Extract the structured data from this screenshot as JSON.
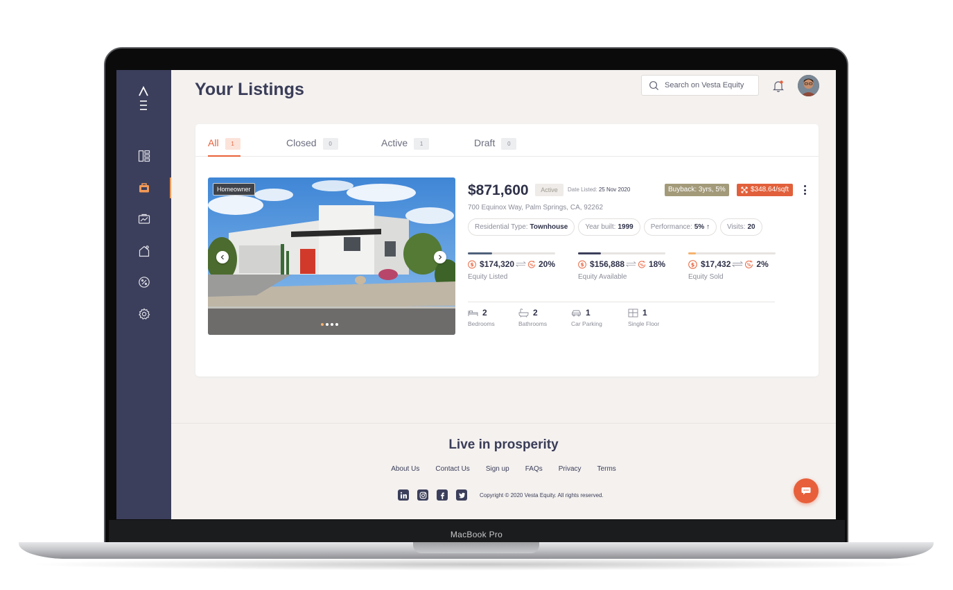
{
  "device": {
    "label": "MacBook Pro"
  },
  "header": {
    "title": "Your Listings",
    "search_placeholder": "Search on Vesta Equity"
  },
  "sidebar": {
    "items": [
      {
        "name": "dashboard",
        "icon": "dashboard-icon",
        "active": false
      },
      {
        "name": "listings",
        "icon": "briefcase-icon",
        "active": true
      },
      {
        "name": "portfolio",
        "icon": "chart-icon",
        "active": false
      },
      {
        "name": "homes",
        "icon": "house-icon",
        "active": false
      },
      {
        "name": "offers",
        "icon": "percent-badge-icon",
        "active": false
      },
      {
        "name": "settings",
        "icon": "gear-icon",
        "active": false
      }
    ]
  },
  "tabs": [
    {
      "label": "All",
      "count": "1",
      "active": true
    },
    {
      "label": "Closed",
      "count": "0",
      "active": false
    },
    {
      "label": "Active",
      "count": "1",
      "active": false
    },
    {
      "label": "Draft",
      "count": "0",
      "active": false
    }
  ],
  "listing": {
    "badge": "Homeowner",
    "price": "$871,600",
    "status": "Active",
    "date_label": "Date Listed:",
    "date": "25 Nov 2020",
    "buyback": "Buyback: 3yrs, 5%",
    "price_per_sqft": "$348.64/sqft",
    "address": "700 Equinox Way, Palm Springs, CA, 92262",
    "chips": [
      {
        "label": "Residential Type:",
        "value": "Townhouse"
      },
      {
        "label": "Year built:",
        "value": "1999"
      },
      {
        "label": "Performance:",
        "value": "5% ↑"
      },
      {
        "label": "Visits:",
        "value": "20"
      }
    ],
    "equity": [
      {
        "amount": "$174,320",
        "percent": "20%",
        "label": "Equity Listed",
        "fill": 0.28,
        "color": "#50617a"
      },
      {
        "amount": "$156,888",
        "percent": "18%",
        "label": "Equity Available",
        "fill": 0.26,
        "color": "#3c3f5b"
      },
      {
        "amount": "$17,432",
        "percent": "2%",
        "label": "Equity Sold",
        "fill": 0.09,
        "color": "#f5b26f"
      }
    ],
    "features": [
      {
        "value": "2",
        "label": "Bedrooms",
        "icon": "bed-icon"
      },
      {
        "value": "2",
        "label": "Bathrooms",
        "icon": "bathtub-icon"
      },
      {
        "value": "1",
        "label": "Car Parking",
        "icon": "car-icon"
      },
      {
        "value": "1",
        "label": "Single Floor",
        "icon": "floor-plan-icon"
      }
    ],
    "photo_count": 4,
    "photo_index": 1
  },
  "footer": {
    "tagline": "Live in prosperity",
    "links": [
      "About Us",
      "Contact Us",
      "Sign up",
      "FAQs",
      "Privacy",
      "Terms"
    ],
    "social": [
      "linkedin-icon",
      "instagram-icon",
      "facebook-icon",
      "twitter-icon"
    ],
    "copyright": "Copyright © 2020 Vesta Equity. All rights reserved."
  },
  "colors": {
    "accent": "#e8613a",
    "sidebar": "#3c3f5b",
    "background": "#f4f1ef"
  }
}
